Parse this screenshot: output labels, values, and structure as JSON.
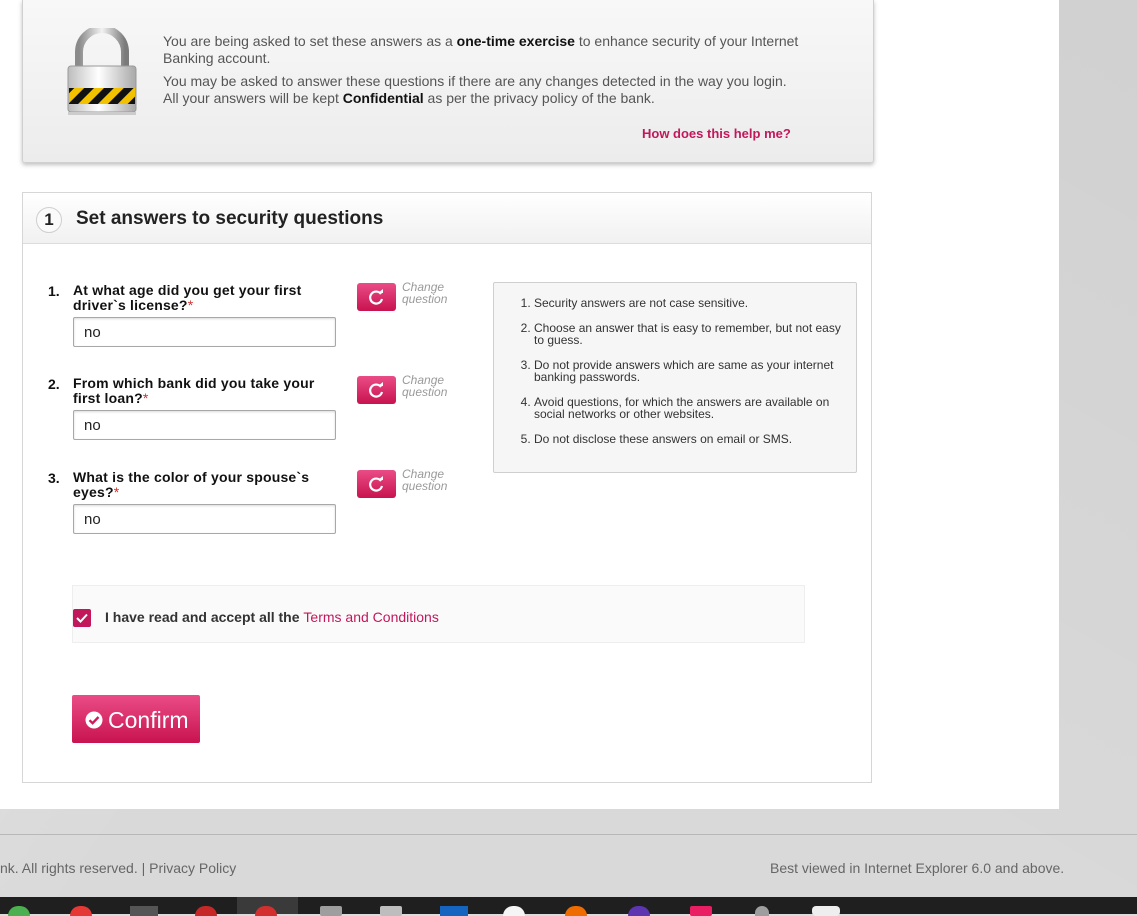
{
  "info": {
    "line1_pre": "You are being asked to set these answers as a ",
    "line1_bold": "one-time exercise",
    "line1_post": " to enhance security of your Internet Banking account.",
    "line2": "You may be asked to answer these questions if there are any changes detected in the way you login.",
    "line3_pre": "All your answers will be kept ",
    "line3_bold": "Confidential",
    "line3_post": " as per the privacy policy of the bank.",
    "help_link": "How does this help me?"
  },
  "section": {
    "step": "1",
    "title": "Set answers to security questions"
  },
  "questions": [
    {
      "num": "1.",
      "text": "At what age did you get your first driver`s license?",
      "required": "*",
      "answer": "no",
      "change_label": "Change question"
    },
    {
      "num": "2.",
      "text": "From which bank did you take your first loan?",
      "required": "*",
      "answer": "no",
      "change_label": "Change question"
    },
    {
      "num": "3.",
      "text": "What is the color of your spouse`s eyes?",
      "required": "*",
      "answer": "no",
      "change_label": "Change question"
    }
  ],
  "tips": [
    "Security answers are not case sensitive.",
    "Choose an answer that is easy to remember, but not easy to guess.",
    "Do not provide answers which are same as your internet banking passwords.",
    "Avoid questions, for which the answers are available on social networks or other websites.",
    "Do not disclose these answers on email or SMS."
  ],
  "terms": {
    "checked": true,
    "text": "I have read and accept all the ",
    "link": "Terms and Conditions"
  },
  "confirm_label": "Confirm",
  "footer": {
    "left": "nk. All rights reserved. | Privacy Policy",
    "right": "Best viewed in Internet Explorer 6.0 and above."
  },
  "colors": {
    "accent": "#c2185b",
    "button_gradient_top": "#ea4c86",
    "button_gradient_bottom": "#c8134f"
  }
}
